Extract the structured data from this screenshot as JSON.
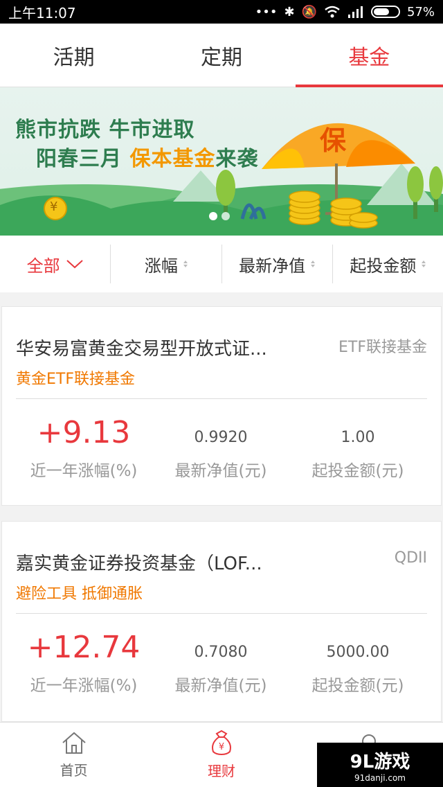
{
  "statusbar": {
    "time": "上午11:07",
    "battery": "57%"
  },
  "tabs": [
    {
      "label": "活期"
    },
    {
      "label": "定期"
    },
    {
      "label": "基金"
    }
  ],
  "banner": {
    "line1": "熊市抗跌 牛市进取",
    "line2_prefix": "阳春三月 ",
    "line2_highlight": "保本基金",
    "line2_suffix": "来袭",
    "umbrella_char": "保",
    "coin_char": "¥"
  },
  "filters": [
    {
      "label": "全部"
    },
    {
      "label": "涨幅"
    },
    {
      "label": "最新净值"
    },
    {
      "label": "起投金额"
    }
  ],
  "funds": [
    {
      "name": "华安易富黄金交易型开放式证...",
      "type": "ETF联接基金",
      "tag": "黄金ETF联接基金",
      "yield": "+9.13",
      "yield_label": "近一年涨幅(%)",
      "nav": "0.9920",
      "nav_label": "最新净值(元)",
      "min": "1.00",
      "min_label": "起投金额(元)"
    },
    {
      "name": "嘉实黄金证券投资基金（LOF...",
      "type": "QDII",
      "tag": "避险工具 抵御通胀",
      "yield": "+12.74",
      "yield_label": "近一年涨幅(%)",
      "nav": "0.7080",
      "nav_label": "最新净值(元)",
      "min": "5000.00",
      "min_label": "起投金额(元)"
    }
  ],
  "bottomnav": [
    {
      "label": "首页"
    },
    {
      "label": "理财"
    }
  ],
  "watermark": {
    "title": "9L游戏",
    "sub": "91danji.com"
  },
  "colors": {
    "accent": "#e8383d",
    "tag": "#f07800",
    "banner_text": "#2e7d4f"
  }
}
